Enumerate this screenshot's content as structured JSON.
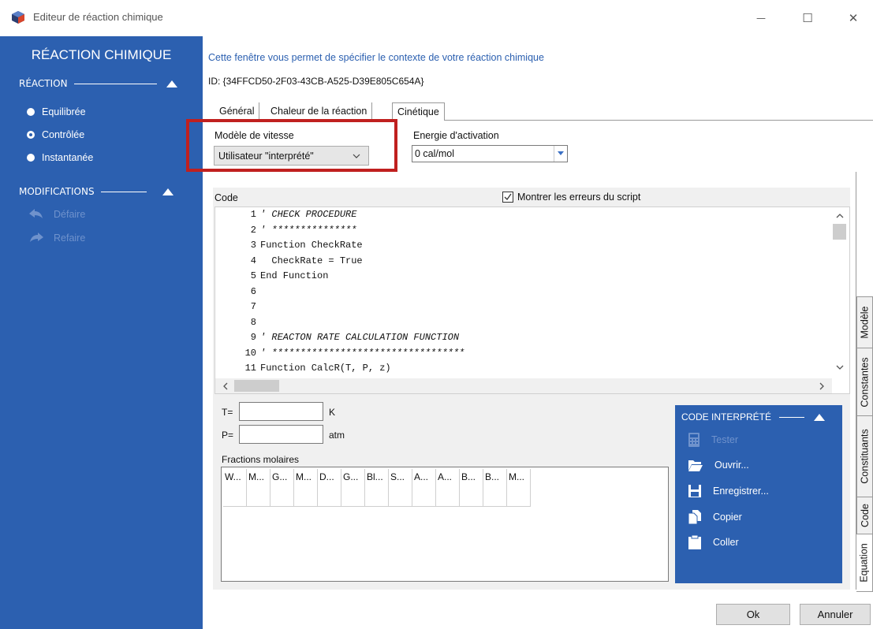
{
  "window": {
    "title": "Editeur de réaction chimique",
    "minimize": "—",
    "maximize": "☐",
    "close": "✕"
  },
  "sidebar": {
    "title": "RÉACTION CHIMIQUE",
    "reaction_header": "RÉACTION",
    "reaction_options": [
      {
        "label": "Equilibrée",
        "checked": false
      },
      {
        "label": "Contrôlée",
        "checked": true
      },
      {
        "label": "Instantanée",
        "checked": false
      }
    ],
    "modifications_header": "MODIFICATIONS",
    "undo_label": "Défaire",
    "redo_label": "Refaire"
  },
  "main": {
    "description": "Cette fenêtre vous permet de spécifier le contexte de votre réaction chimique",
    "id": "ID: {34FFCD50-2F03-43CB-A525-D39E805C654A}",
    "tabs": [
      "Général",
      "Chaleur de la réaction",
      "Cinétique"
    ],
    "rate_model_label": "Modèle de vitesse",
    "rate_model_value": "Utilisateur \"interprété\"",
    "activation_label": "Energie d'activation",
    "activation_value": "0 cal/mol",
    "code_label": "Code",
    "show_errors_label": "Montrer les erreurs du script",
    "show_errors_checked": true
  },
  "code_lines": [
    {
      "n": "1",
      "text": "' CHECK PROCEDURE",
      "comment": true
    },
    {
      "n": "2",
      "text": "' ***************",
      "comment": true
    },
    {
      "n": "3",
      "text": "Function CheckRate",
      "comment": false
    },
    {
      "n": "4",
      "text": "  CheckRate = True",
      "comment": false
    },
    {
      "n": "5",
      "text": "End Function",
      "comment": false
    },
    {
      "n": "6",
      "text": "",
      "comment": false
    },
    {
      "n": "7",
      "text": "",
      "comment": false
    },
    {
      "n": "8",
      "text": "",
      "comment": false
    },
    {
      "n": "9",
      "text": "' REACTON RATE CALCULATION FUNCTION",
      "comment": true
    },
    {
      "n": "10",
      "text": "' **********************************",
      "comment": true
    },
    {
      "n": "11",
      "text": "Function CalcR(T, P, z)",
      "comment": false
    }
  ],
  "variables": {
    "t_label": "T=",
    "t_value": "",
    "t_unit": "K",
    "p_label": "P=",
    "p_value": "",
    "p_unit": "atm",
    "fractions_label": "Fractions molaires",
    "fraction_columns": [
      "W...",
      "M...",
      "G...",
      "M...",
      "D...",
      "G...",
      "Bl...",
      "S...",
      "A...",
      "A...",
      "B...",
      "B...",
      "M..."
    ]
  },
  "interpreted_panel": {
    "header": "CODE INTERPRÉTÉ",
    "items": [
      {
        "label": "Tester",
        "icon": "calculator-icon",
        "enabled": false
      },
      {
        "label": "Ouvrir...",
        "icon": "folder-open-icon",
        "enabled": true
      },
      {
        "label": "Enregistrer...",
        "icon": "floppy-disk-icon",
        "enabled": true
      },
      {
        "label": "Copier",
        "icon": "copy-icon",
        "enabled": true
      },
      {
        "label": "Coller",
        "icon": "paste-icon",
        "enabled": true
      }
    ]
  },
  "vertical_tabs": [
    "Modèle",
    "Constantes",
    "Constituants",
    "Code",
    "Equation"
  ],
  "buttons": {
    "ok": "Ok",
    "cancel": "Annuler"
  },
  "colors": {
    "sidebar_bg": "#2c60b0",
    "disabled_text": "#6f92cc",
    "highlight": "#c0201f"
  }
}
